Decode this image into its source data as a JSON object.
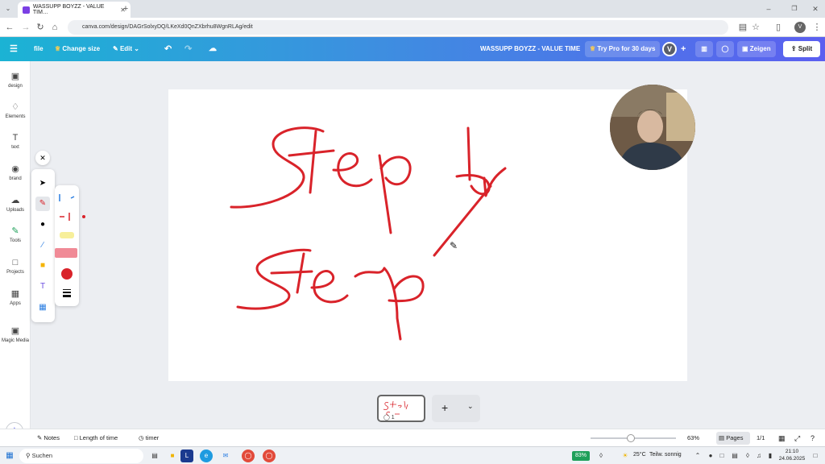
{
  "browser": {
    "tab_title": "WASSUPP BOYZZ - VALUE TIM…",
    "url": "canva.com/design/DAGrSolxyDQ/LKeXd0QnZXbrhu8WgnRLAg/edit"
  },
  "topbar": {
    "file": "file",
    "change_size": "Change size",
    "edit": "Edit",
    "design_title": "WASSUPP BOYZZ - VALUE TIME",
    "try_pro": "Try Pro for 30 days",
    "avatar": "V",
    "present": "Zeigen",
    "share": "Split"
  },
  "sidebar": {
    "items": [
      {
        "label": "design",
        "icon": "design-icon"
      },
      {
        "label": "Elements",
        "icon": "elements-icon"
      },
      {
        "label": "text",
        "icon": "text-icon"
      },
      {
        "label": "brand",
        "icon": "brand-icon"
      },
      {
        "label": "Uploads",
        "icon": "uploads-icon"
      },
      {
        "label": "Tools",
        "icon": "tools-icon"
      },
      {
        "label": "Projects",
        "icon": "projects-icon"
      },
      {
        "label": "Apps",
        "icon": "apps-icon"
      },
      {
        "label": "Magic Media",
        "icon": "magic-media-icon"
      }
    ]
  },
  "canvas": {
    "drawing_color": "#d9232a"
  },
  "pages": {
    "current_number": "1"
  },
  "bottombar": {
    "notes": "Notes",
    "length": "Length of time",
    "timer": "timer",
    "zoom": "63%",
    "pages_btn": "Pages",
    "page_count": "1/1"
  },
  "taskbar": {
    "search": "Suchen",
    "battery": "83%",
    "weather": "25°C",
    "weather_desc": "Teilw. sonnig",
    "time": "21:10",
    "date": "24.06.2025"
  }
}
